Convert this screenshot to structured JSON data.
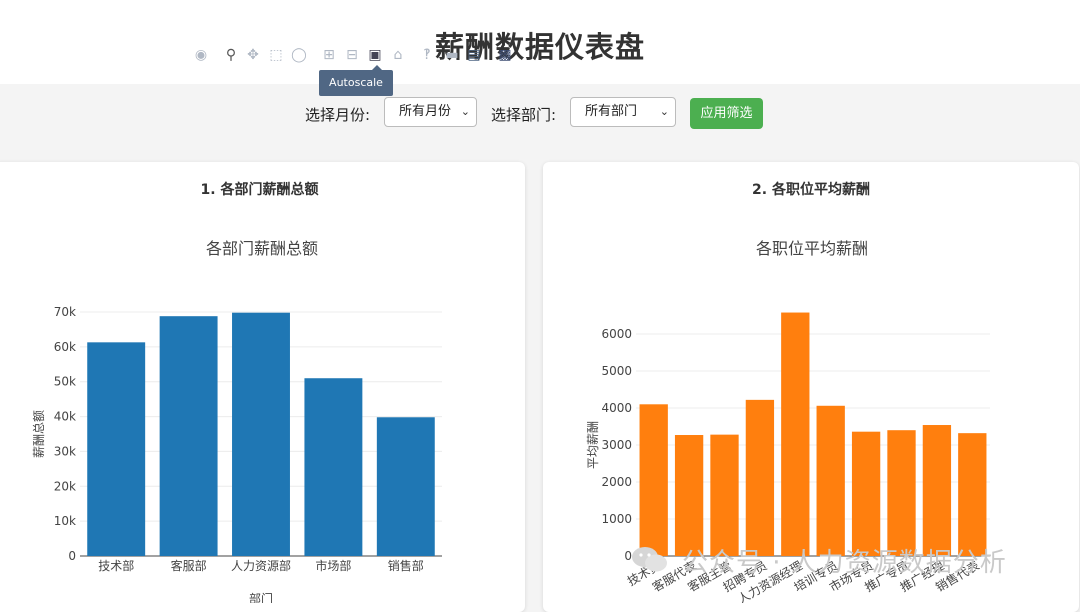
{
  "header": {
    "title": "薪酬数据仪表盘"
  },
  "filters": {
    "month_label": "选择月份:",
    "month_value": "所有月份",
    "dept_label": "选择部门:",
    "dept_value": "所有部门",
    "apply_label": "应用筛选"
  },
  "panel1": {
    "title": "1. 各部门薪酬总额",
    "tooltip": "Autoscale",
    "modebar_icons": [
      "camera-icon",
      "zoom-icon",
      "pan-icon",
      "box-select-icon",
      "lasso-icon",
      "zoom-in-icon",
      "zoom-out-icon",
      "autoscale-icon",
      "home-icon",
      "spike-icon",
      "hover-closest-icon",
      "hover-compare-icon",
      "plotly-logo-icon"
    ]
  },
  "panel2": {
    "title": "2. 各职位平均薪酬"
  },
  "watermark": {
    "text": "公众号 · 人力资源数据分析"
  },
  "chart_data": [
    {
      "type": "bar",
      "title": "各部门薪酬总额",
      "xlabel": "部门",
      "ylabel": "薪酬总额",
      "categories": [
        "技术部",
        "客服部",
        "人力资源部",
        "市场部",
        "销售部"
      ],
      "values": [
        61300,
        68800,
        69800,
        51000,
        39800
      ],
      "ylim": [
        0,
        75000
      ],
      "yticks": [
        0,
        10000,
        20000,
        30000,
        40000,
        50000,
        60000,
        70000
      ],
      "ytick_labels": [
        "0",
        "10k",
        "20k",
        "30k",
        "40k",
        "50k",
        "60k",
        "70k"
      ],
      "color": "#1f77b4",
      "grid": true
    },
    {
      "type": "bar",
      "title": "各职位平均薪酬",
      "xlabel": "",
      "ylabel": "平均薪酬",
      "categories": [
        "技术员",
        "客服代表",
        "客服主管",
        "招聘专员",
        "人力资源经理",
        "培训专员",
        "市场专员",
        "推广专员",
        "推广经理",
        "销售代表"
      ],
      "values": [
        4100,
        3270,
        3280,
        4220,
        6580,
        4060,
        3360,
        3400,
        3540,
        3320
      ],
      "ylim": [
        0,
        7000
      ],
      "yticks": [
        0,
        1000,
        2000,
        3000,
        4000,
        5000,
        6000
      ],
      "ytick_labels": [
        "0",
        "1000",
        "2000",
        "3000",
        "4000",
        "5000",
        "6000"
      ],
      "color": "#ff7f0e",
      "grid": true
    }
  ]
}
